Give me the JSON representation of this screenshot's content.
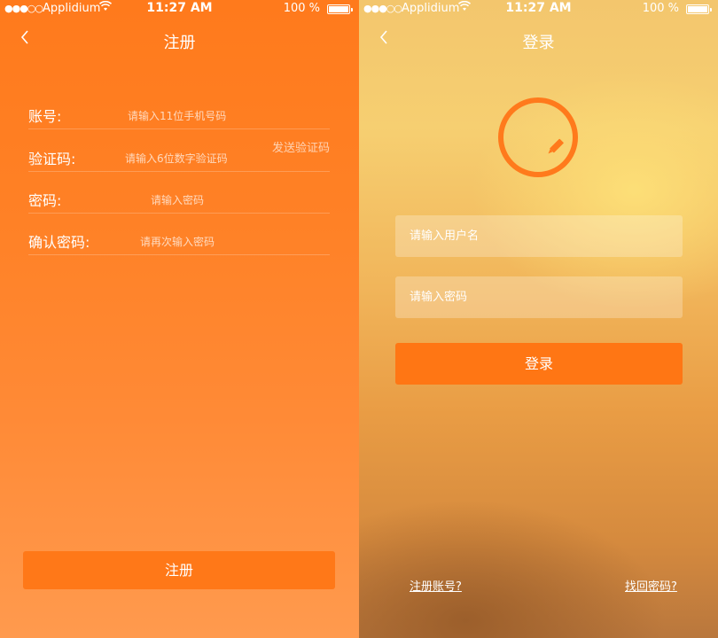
{
  "status_bar": {
    "signal": "●●●○○",
    "carrier": "Applidium",
    "time": "11:27 AM",
    "battery": "100 %"
  },
  "register": {
    "title": "注册",
    "fields": [
      {
        "label": "账号:",
        "placeholder": "请输入11位手机号码"
      },
      {
        "label": "验证码:",
        "placeholder": "请输入6位数字验证码"
      },
      {
        "label": "密码:",
        "placeholder": "请输入密码"
      },
      {
        "label": "确认密码:",
        "placeholder": "请再次输入密码"
      }
    ],
    "send_code": "发送验证码",
    "submit": "注册"
  },
  "login": {
    "title": "登录",
    "username_placeholder": "请输入用户名",
    "password_placeholder": "请输入密码",
    "submit": "登录",
    "register_link": "注册账号?",
    "forgot_link": "找回密码?"
  },
  "icons": {
    "back": "chevron-left-icon",
    "wifi": "wifi-icon",
    "battery": "battery-icon",
    "logo": "pencil-circle-logo"
  },
  "colors": {
    "accent": "#ff7614"
  }
}
